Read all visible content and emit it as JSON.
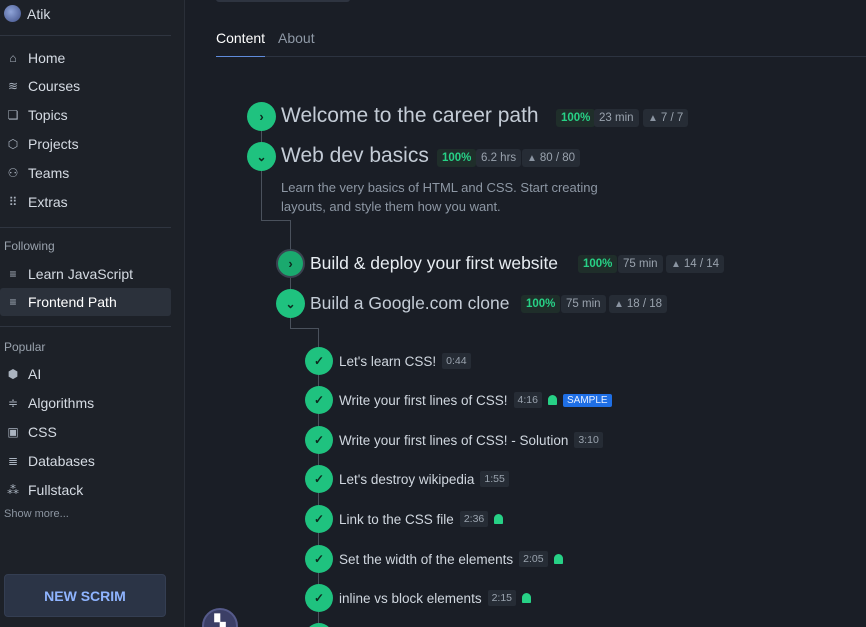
{
  "user": {
    "name": "Atik"
  },
  "nav": [
    {
      "label": "Home",
      "icon": "home-icon",
      "glyph": "⌂"
    },
    {
      "label": "Courses",
      "icon": "courses-icon",
      "glyph": "≋"
    },
    {
      "label": "Topics",
      "icon": "topics-icon",
      "glyph": "❏"
    },
    {
      "label": "Projects",
      "icon": "projects-icon",
      "glyph": "⬡"
    },
    {
      "label": "Teams",
      "icon": "teams-icon",
      "glyph": "⚇"
    },
    {
      "label": "Extras",
      "icon": "extras-icon",
      "glyph": "⠿"
    }
  ],
  "following": {
    "title": "Following",
    "items": [
      {
        "label": "Learn JavaScript",
        "icon": "course-icon",
        "glyph": "≡"
      },
      {
        "label": "Frontend Path",
        "icon": "course-icon",
        "glyph": "≡"
      }
    ]
  },
  "popular": {
    "title": "Popular",
    "items": [
      {
        "label": "AI",
        "icon": "ai-icon",
        "glyph": "⬢"
      },
      {
        "label": "Algorithms",
        "icon": "algorithms-icon",
        "glyph": "≑"
      },
      {
        "label": "CSS",
        "icon": "css-icon",
        "glyph": "▣"
      },
      {
        "label": "Databases",
        "icon": "database-icon",
        "glyph": "≣"
      },
      {
        "label": "Fullstack",
        "icon": "fullstack-icon",
        "glyph": "⁂"
      }
    ],
    "show_more": "Show more..."
  },
  "new_scrim": "NEW SCRIM",
  "tabs": {
    "content": "Content",
    "about": "About"
  },
  "modules": {
    "welcome": {
      "title": "Welcome to the career path",
      "pct": "100%",
      "time": "23 min",
      "count": "7 / 7"
    },
    "webdev": {
      "title": "Web dev basics",
      "pct": "100%",
      "time": "6.2 hrs",
      "count": "80 / 80",
      "desc": "Learn the very basics of HTML and CSS. Start creating layouts, and style them how you want."
    },
    "build": {
      "title": "Build & deploy your first website",
      "pct": "100%",
      "time": "75 min",
      "count": "14 / 14"
    },
    "google": {
      "title": "Build a Google.com clone",
      "pct": "100%",
      "time": "75 min",
      "count": "18 / 18"
    }
  },
  "lessons": [
    {
      "title": "Let's learn CSS!",
      "dur": "0:44",
      "ghost": false,
      "sample": ""
    },
    {
      "title": "Write your first lines of CSS!",
      "dur": "4:16",
      "ghost": true,
      "sample": "SAMPLE"
    },
    {
      "title": "Write your first lines of CSS! - Solution",
      "dur": "3:10",
      "ghost": false,
      "sample": ""
    },
    {
      "title": "Let's destroy wikipedia",
      "dur": "1:55",
      "ghost": false,
      "sample": ""
    },
    {
      "title": "Link to the CSS file",
      "dur": "2:36",
      "ghost": true,
      "sample": ""
    },
    {
      "title": "Set the width of the elements",
      "dur": "2:05",
      "ghost": true,
      "sample": ""
    },
    {
      "title": "inline vs block elements",
      "dur": "2:15",
      "ghost": true,
      "sample": ""
    }
  ],
  "colors": {
    "accent": "#1fc27f",
    "sample_badge": "#1f6fe5",
    "new_scrim_text": "#8fb4ff"
  }
}
